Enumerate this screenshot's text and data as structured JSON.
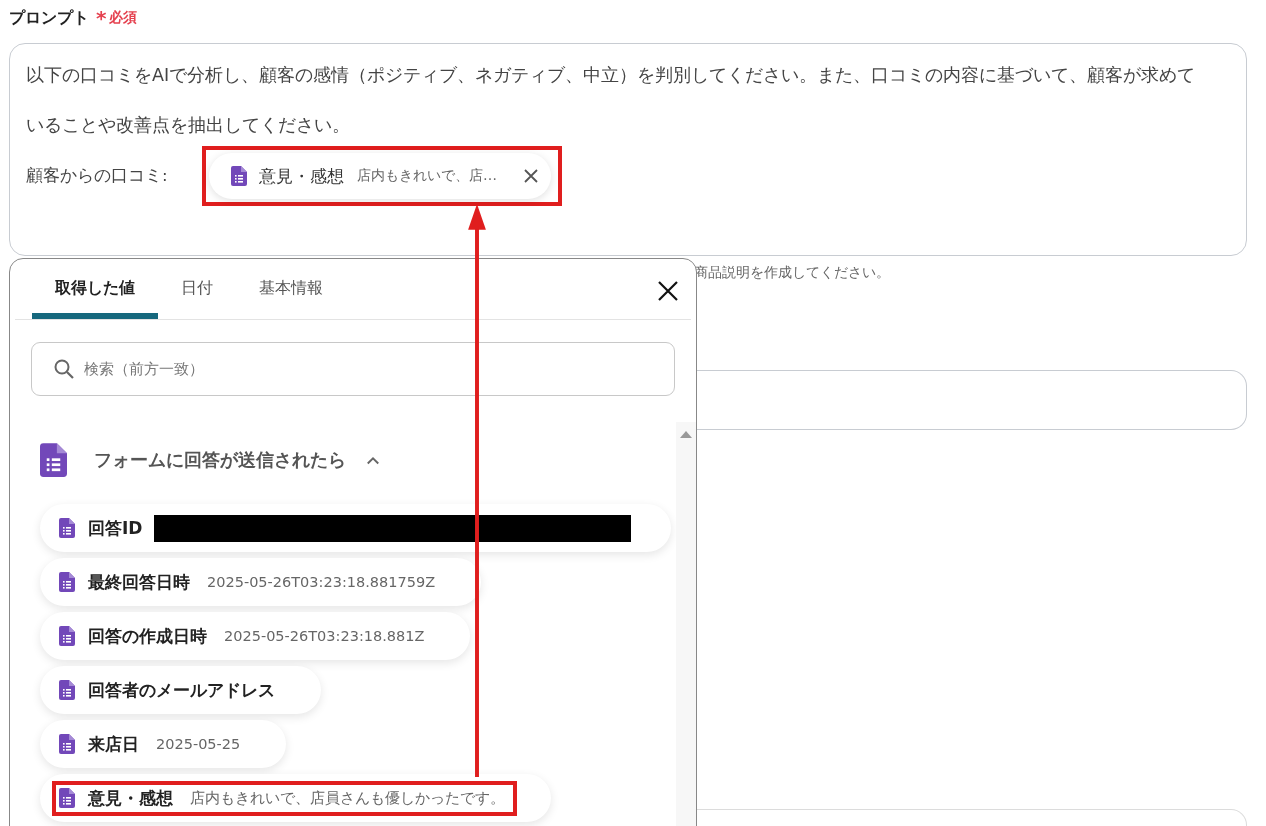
{
  "field_label": {
    "text": "プロンプト",
    "required_mark": "*",
    "required_text": "必須"
  },
  "prompt": {
    "text": "以下の口コミをAIで分析し、顧客の感情（ポジティブ、ネガティブ、中立）を判別してください。また、口コミの内容に基づいて、顧客が求めていることや改善点を抽出してください。",
    "variable_label": "顧客からの口コミ:",
    "chip": {
      "name": "意見・感想",
      "value": "店内もきれいで、店…",
      "highlighted": true
    }
  },
  "hint": "商品説明を作成してください。",
  "popup": {
    "tabs": [
      {
        "label": "取得した値",
        "selected": true
      },
      {
        "label": "日付",
        "selected": false
      },
      {
        "label": "基本情報",
        "selected": false
      }
    ],
    "search": {
      "placeholder": "検索（前方一致）"
    },
    "group": {
      "title": "フォームに回答が送信されたら",
      "expanded": true
    },
    "items": [
      {
        "name": "回答ID",
        "redacted": true,
        "highlighted": false
      },
      {
        "name": "最終回答日時",
        "value": "2025-05-26T03:23:18.881759Z",
        "redacted": false,
        "highlighted": false
      },
      {
        "name": "回答の作成日時",
        "value": "2025-05-26T03:23:18.881Z",
        "redacted": false,
        "highlighted": false
      },
      {
        "name": "回答者のメールアドレス",
        "redacted": false,
        "highlighted": false
      },
      {
        "name": "来店日",
        "value": "2025-05-25",
        "redacted": false,
        "highlighted": false
      },
      {
        "name": "意見・感想",
        "value": "店内もきれいで、店員さんも優しかったです。",
        "redacted": false,
        "highlighted": true
      }
    ]
  }
}
